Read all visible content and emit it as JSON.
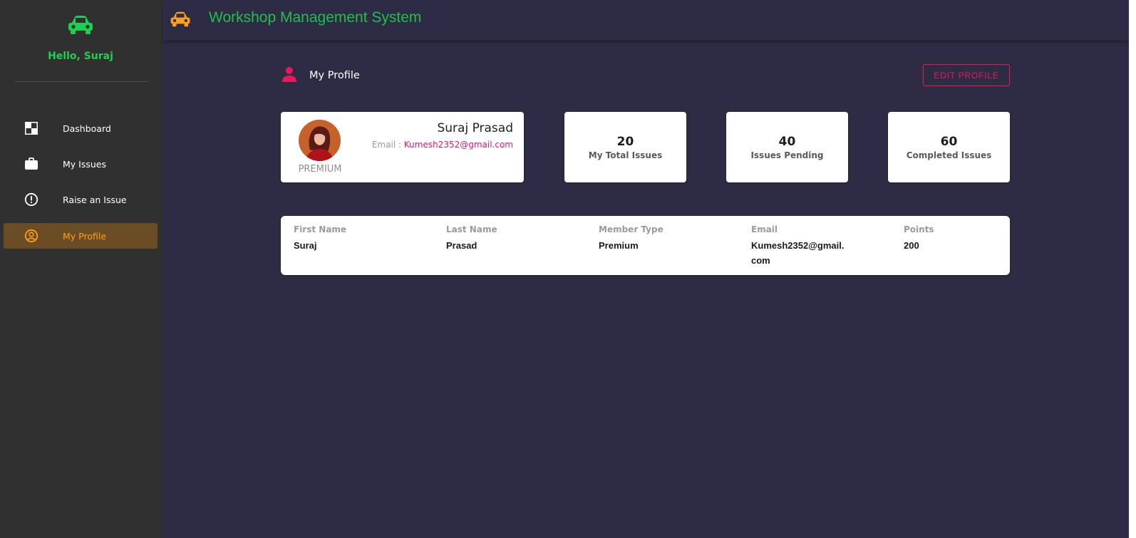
{
  "app": {
    "title": "Workshop Management System"
  },
  "sidebar": {
    "greeting": "Hello, Suraj",
    "items": [
      {
        "label": "Dashboard",
        "icon": "dashboard-icon",
        "active": false
      },
      {
        "label": "My Issues",
        "icon": "briefcase-icon",
        "active": false
      },
      {
        "label": "Raise an Issue",
        "icon": "alert-circle-icon",
        "active": false
      },
      {
        "label": "My Profile",
        "icon": "user-circle-icon",
        "active": true
      }
    ]
  },
  "page": {
    "title": "My Profile",
    "edit_button": "EDIT PROFILE"
  },
  "profile_card": {
    "name": "Suraj Prasad",
    "email_label": "Email : ",
    "email": "Kumesh2352@gmail.com",
    "member_type": "PREMIUM"
  },
  "stats": [
    {
      "value": "20",
      "label": "My Total Issues"
    },
    {
      "value": "40",
      "label": "Issues Pending"
    },
    {
      "value": "60",
      "label": "Completed Issues"
    }
  ],
  "details": {
    "columns": [
      {
        "header": "First Name",
        "value": "Suraj"
      },
      {
        "header": "Last Name",
        "value": "Prasad"
      },
      {
        "header": "Member Type",
        "value": "Premium"
      },
      {
        "header": "Email",
        "value": "Kumesh2352@gmail.com"
      },
      {
        "header": "Points",
        "value": "200"
      }
    ]
  },
  "colors": {
    "sidebar_bg": "#303030",
    "main_bg": "#2e2c44",
    "brand_green": "#1fbf4a",
    "accent_orange": "#ff9f1a",
    "accent_pink": "#e8185e"
  }
}
